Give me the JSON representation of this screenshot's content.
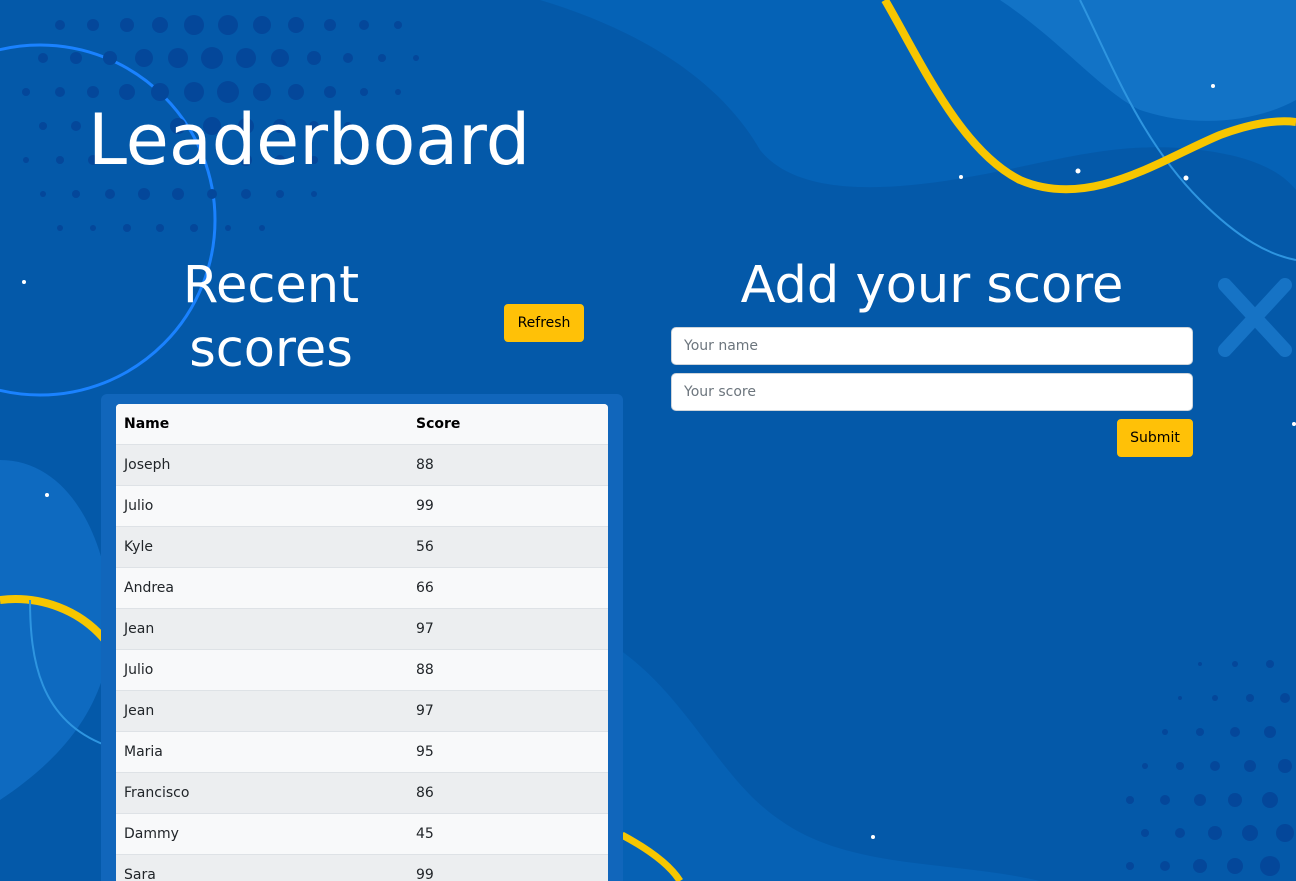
{
  "page": {
    "title": "Leaderboard"
  },
  "recent": {
    "heading": "Recent scores",
    "refresh_label": "Refresh",
    "columns": [
      "Name",
      "Score"
    ],
    "rows": [
      {
        "name": "Joseph",
        "score": "88"
      },
      {
        "name": "Julio",
        "score": "99"
      },
      {
        "name": "Kyle",
        "score": "56"
      },
      {
        "name": "Andrea",
        "score": "66"
      },
      {
        "name": "Jean",
        "score": "97"
      },
      {
        "name": "Julio",
        "score": "88"
      },
      {
        "name": "Jean",
        "score": "97"
      },
      {
        "name": "Maria",
        "score": "95"
      },
      {
        "name": "Francisco",
        "score": "86"
      },
      {
        "name": "Dammy",
        "score": "45"
      },
      {
        "name": "Sara",
        "score": "99"
      }
    ]
  },
  "add_score": {
    "heading": "Add your score",
    "name_placeholder": "Your name",
    "name_value": "",
    "score_placeholder": "Your score",
    "score_value": "",
    "submit_label": "Submit"
  },
  "colors": {
    "background": "#0458a8",
    "accent_yellow": "#ffc107",
    "swirl_yellow": "#f7c600",
    "outline_blue": "#1a82ff"
  }
}
